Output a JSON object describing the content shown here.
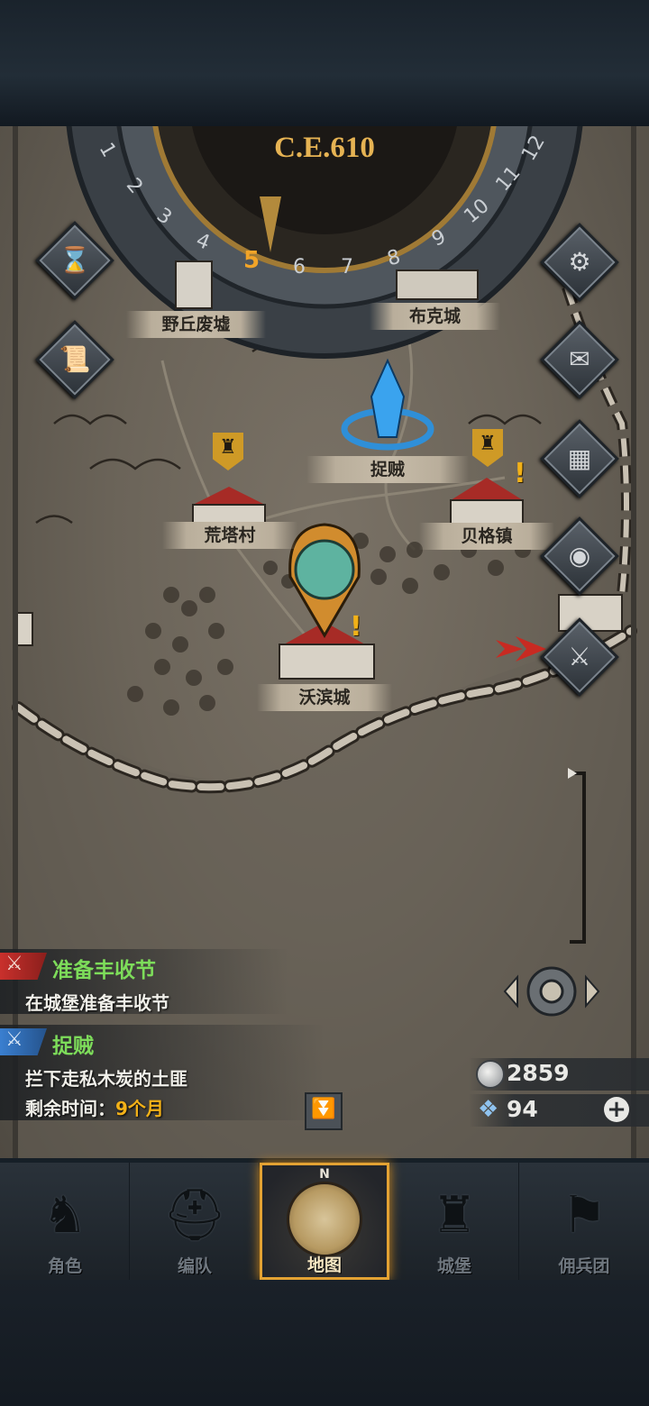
{
  "calendar": {
    "year": "C.E.610",
    "months": [
      "1",
      "2",
      "3",
      "4",
      "5",
      "6",
      "7",
      "8",
      "9",
      "10",
      "11",
      "12"
    ],
    "current_month": "5"
  },
  "places": {
    "yeqiu": "野丘废墟",
    "buke": "布克城",
    "zhuozei": "捉贼",
    "huangta": "荒塔村",
    "beige": "贝格镇",
    "wobin": "沃滨城"
  },
  "side_buttons_left": [
    {
      "icon": "hourglass-icon"
    },
    {
      "icon": "scroll-icon"
    }
  ],
  "side_buttons_right": [
    {
      "icon": "gear-icon"
    },
    {
      "icon": "mail-icon"
    },
    {
      "icon": "board-icon"
    },
    {
      "icon": "coin-icon"
    },
    {
      "icon": "battle-icon"
    }
  ],
  "quests": [
    {
      "title": "准备丰收节",
      "desc": "在城堡准备丰收节",
      "title_color": "#7ddc5a",
      "tag_color": "#c9302c"
    },
    {
      "title": "捉贼",
      "desc": "拦下走私木炭的土匪",
      "time_label": "剩余时间：",
      "time_value": "9个月",
      "title_color": "#7ddc5a",
      "tag_color": "#3a7fd0"
    }
  ],
  "resources": {
    "silver": "2859",
    "crystal": "94"
  },
  "nav": {
    "tabs": [
      "角色",
      "编队",
      "地图",
      "城堡",
      "佣兵团"
    ],
    "active": "地图",
    "compass_n": "N"
  },
  "colors": {
    "accent": "#e3a233",
    "time_value": "#f2b118"
  }
}
